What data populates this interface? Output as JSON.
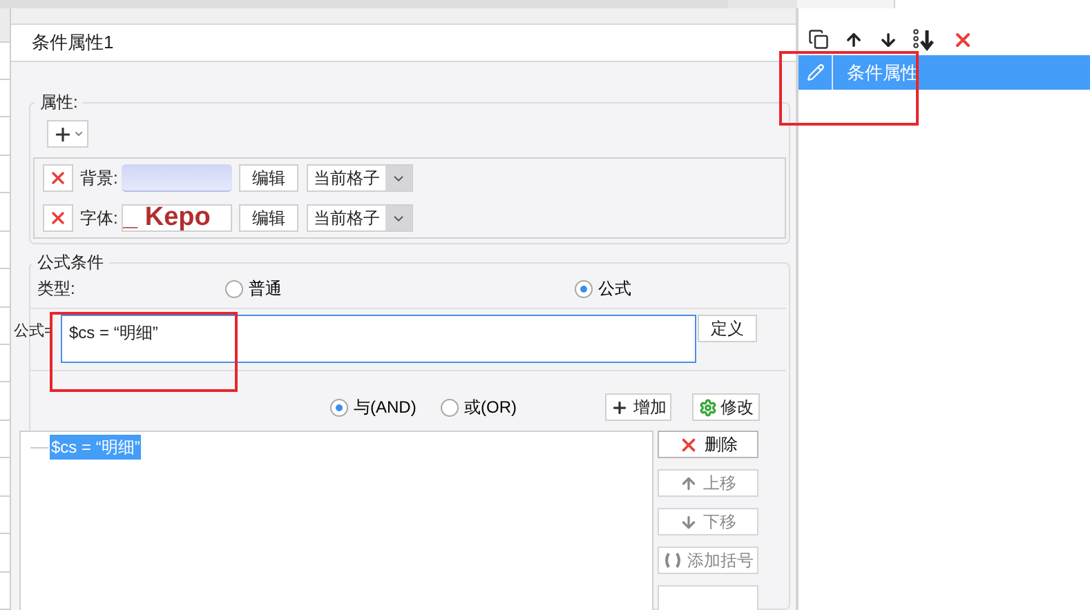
{
  "dialog": {
    "title": "条件属性1",
    "properties": {
      "legend": "属性:",
      "rows": [
        {
          "kind": "color",
          "label": "背景:",
          "edit": "编辑",
          "scope": "当前格子"
        },
        {
          "kind": "font",
          "label": "字体:",
          "preview": "_ Kepo",
          "edit": "编辑",
          "scope": "当前格子"
        }
      ]
    },
    "formula_condition": {
      "legend": "公式条件",
      "type_label": "类型:",
      "types": [
        {
          "label": "普通",
          "selected": false
        },
        {
          "label": "公式",
          "selected": true
        }
      ],
      "formula_label": "公式=",
      "formula": "$cs = “明细”",
      "define_button": "定义",
      "joins": [
        {
          "label": "与(AND)",
          "selected": true
        },
        {
          "label": "或(OR)",
          "selected": false
        }
      ],
      "add_button": "增加",
      "modify_button": "修改",
      "conditions": [
        {
          "text": "$cs = “明细”",
          "selected": true
        }
      ],
      "actions": [
        {
          "kind": "delete",
          "label": "删除",
          "disabled": false
        },
        {
          "kind": "up",
          "label": "上移",
          "disabled": true
        },
        {
          "kind": "down",
          "label": "下移",
          "disabled": true
        },
        {
          "kind": "add_paren",
          "label": "添加括号",
          "disabled": true
        },
        {
          "kind": "remove_paren",
          "disabled": true
        }
      ]
    }
  },
  "side_panel": {
    "items": [
      {
        "label": "条件属性",
        "selected": true
      }
    ]
  }
}
